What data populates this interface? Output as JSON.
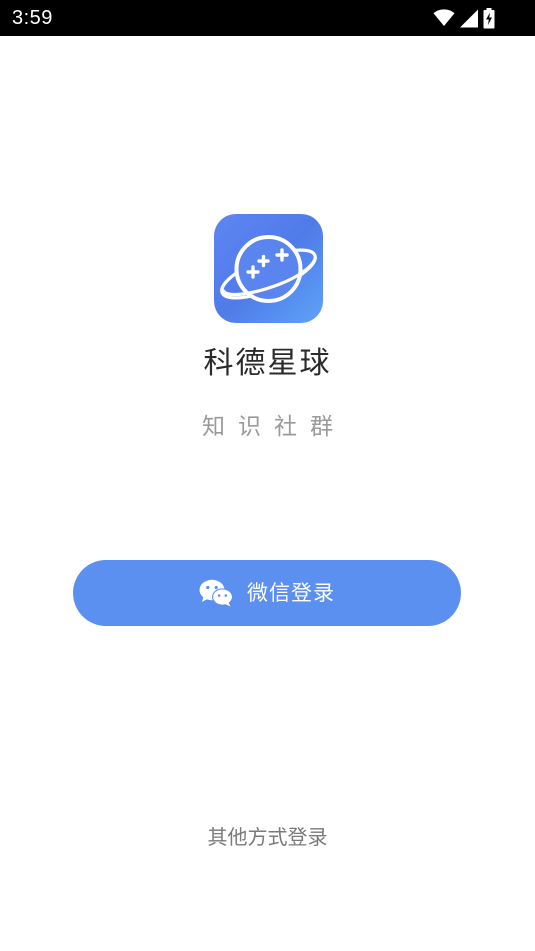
{
  "status_bar": {
    "time": "3:59",
    "icons": [
      "wifi-icon",
      "cellular-signal-icon",
      "battery-charging-icon"
    ]
  },
  "app": {
    "name": "科德星球",
    "slogan": "知识社群",
    "logo_icon": "planet-gamepad-icon"
  },
  "login": {
    "wechat_button_label": "微信登录",
    "wechat_icon": "wechat-icon",
    "other_methods_label": "其他方式登录"
  },
  "colors": {
    "primary": "#5b90f0",
    "logo_gradient_start": "#5f86f2",
    "logo_gradient_end": "#5ea3f7",
    "title_text": "#2b2b2b",
    "slogan_text": "#9a9a9a",
    "secondary_text": "#7a7a7a"
  }
}
